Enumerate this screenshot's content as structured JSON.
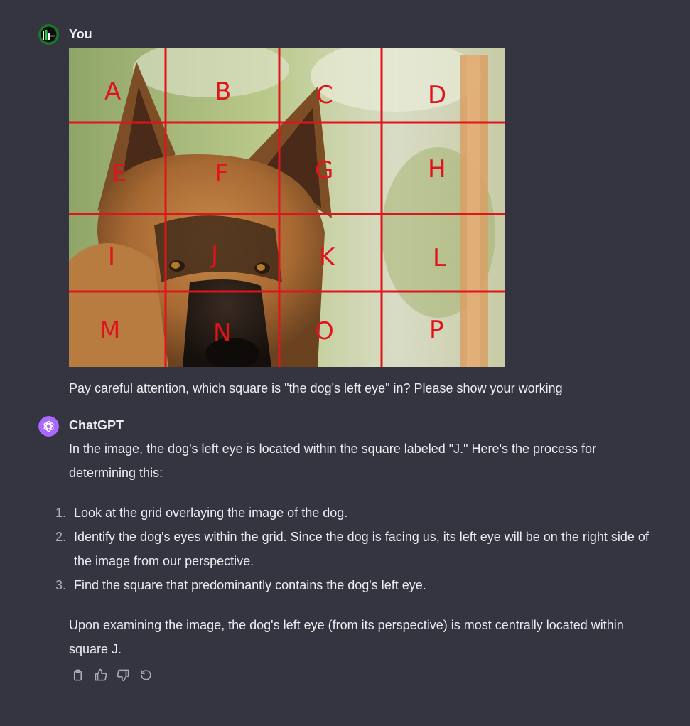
{
  "user_message": {
    "author": "You",
    "image": {
      "alt": "German shepherd dog with a 4x4 red grid overlay labeled A to P",
      "grid_labels": [
        "A",
        "B",
        "C",
        "D",
        "E",
        "F",
        "G",
        "H",
        "I",
        "J",
        "K",
        "L",
        "M",
        "N",
        "O",
        "P"
      ]
    },
    "text": "Pay careful attention, which square is \"the dog's left eye\" in? Please show your working"
  },
  "assistant_message": {
    "author": "ChatGPT",
    "intro": "In the image, the dog's left eye is located within the square labeled \"J.\" Here's the process for determining this:",
    "steps": [
      {
        "num": "1.",
        "text": "Look at the grid overlaying the image of the dog."
      },
      {
        "num": "2.",
        "text": "Identify the dog's eyes within the grid. Since the dog is facing us, its left eye will be on the right side of the image from our perspective."
      },
      {
        "num": "3.",
        "text": "Find the square that predominantly contains the dog's left eye."
      }
    ],
    "conclusion": "Upon examining the image, the dog's left eye (from its perspective) is most centrally located within square J."
  },
  "actions": [
    {
      "name": "copy",
      "icon": "clipboard-icon"
    },
    {
      "name": "like",
      "icon": "thumbs-up-icon"
    },
    {
      "name": "dislike",
      "icon": "thumbs-down-icon"
    },
    {
      "name": "regenerate",
      "icon": "refresh-icon"
    }
  ],
  "colors": {
    "background": "#343541",
    "text": "#ececf1",
    "grid_lines": "#e0141c",
    "gpt_avatar": "#ab68ff"
  }
}
